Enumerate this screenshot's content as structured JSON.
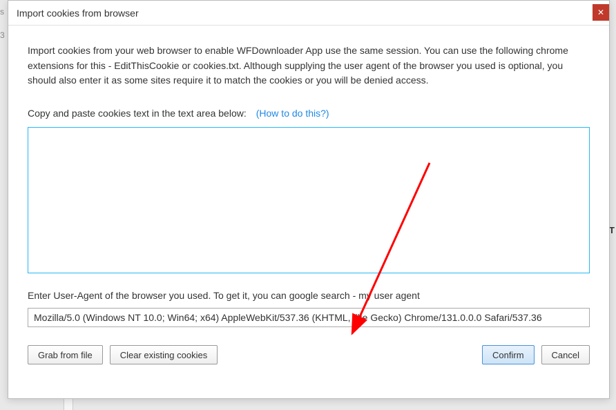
{
  "bgFragments": {
    "left": "s",
    "right": "T",
    "leftNum": "3"
  },
  "dialog": {
    "title": "Import cookies from browser",
    "closeGlyph": "✕",
    "intro": "Import cookies from your web browser to enable WFDownloader App use the same session. You can use the following chrome extensions for this - EditThisCookie or cookies.txt. Although supplying the user agent of the browser you used is optional, you should also enter it as some sites require it to match the cookies or you will be denied access.",
    "cookiesLabel": "Copy and paste cookies text in the text area below:",
    "howToLink": "(How to do this?)",
    "cookiesValue": "",
    "uaLabel": "Enter User-Agent of the browser you used. To get it, you can google search - my user agent",
    "uaValue": "Mozilla/5.0 (Windows NT 10.0; Win64; x64) AppleWebKit/537.36 (KHTML, like Gecko) Chrome/131.0.0.0 Safari/537.36",
    "buttons": {
      "grabFromFile": "Grab from file",
      "clearExisting": "Clear existing cookies",
      "confirm": "Confirm",
      "cancel": "Cancel"
    }
  }
}
